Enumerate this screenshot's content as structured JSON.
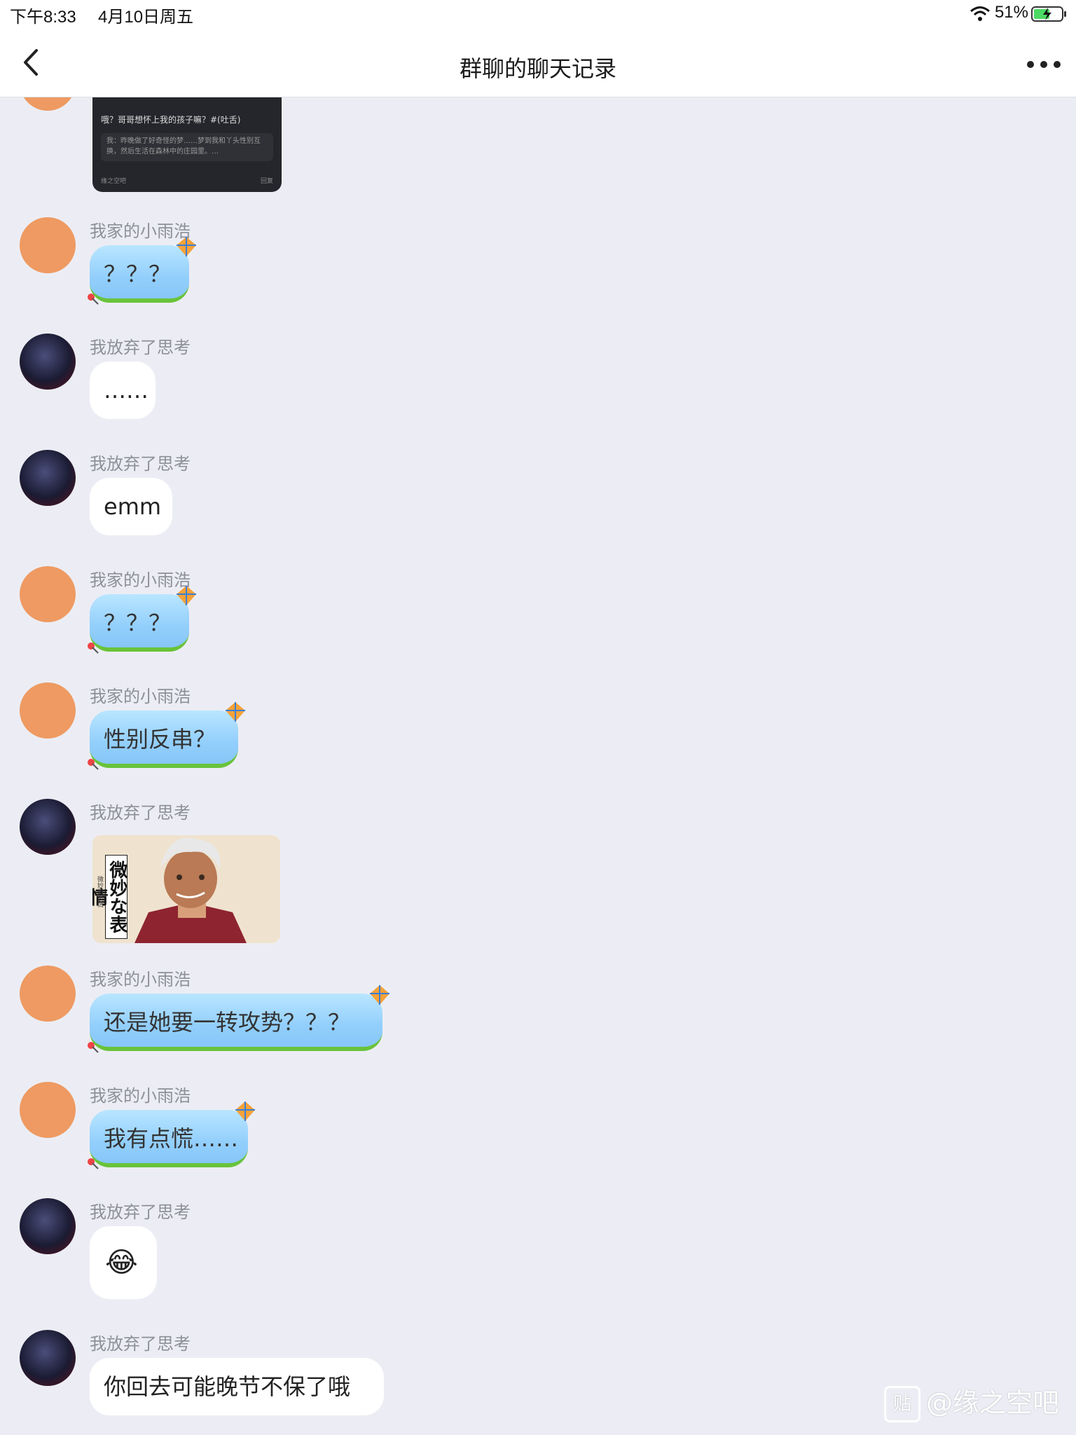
{
  "status_bar": {
    "time": "下午8:33",
    "date": "4月10日周五",
    "battery": "51%"
  },
  "nav": {
    "title": "群聊的聊天记录"
  },
  "top_card": {
    "text": "哦？哥哥想怀上我的孩子嘛？#(吐舌)",
    "quote": "我：昨晚做了好奇怪的梦……梦到我和丫头性别互换，然后生活在森林中的庄园里。…",
    "footer": "缘之空吧",
    "reply": "回复"
  },
  "messages": [
    {
      "sender": "我家的小雨浩",
      "text": "？？？"
    },
    {
      "sender": "我放弃了思考",
      "text": "……"
    },
    {
      "sender": "我放弃了思考",
      "text": "emm"
    },
    {
      "sender": "我家的小雨浩",
      "text": "？？？"
    },
    {
      "sender": "我家的小雨浩",
      "text": "性别反串？"
    },
    {
      "sender": "我放弃了思考",
      "sticker_text": "微妙な表情",
      "sticker_small": "微妙的表情"
    },
    {
      "sender": "我家的小雨浩",
      "text": "还是她要一转攻势？？？"
    },
    {
      "sender": "我家的小雨浩",
      "text": "我有点慌……"
    },
    {
      "sender": "我放弃了思考",
      "text": "😂"
    },
    {
      "sender": "我放弃了思考",
      "text": "你回去可能晚节不保了哦"
    }
  ],
  "watermark": {
    "icon_text": "贴",
    "text": "@缘之空吧"
  },
  "icons": [
    "back-chevron-icon",
    "more-dots-icon",
    "wifi-icon",
    "battery-charging-icon",
    "kite-icon"
  ]
}
